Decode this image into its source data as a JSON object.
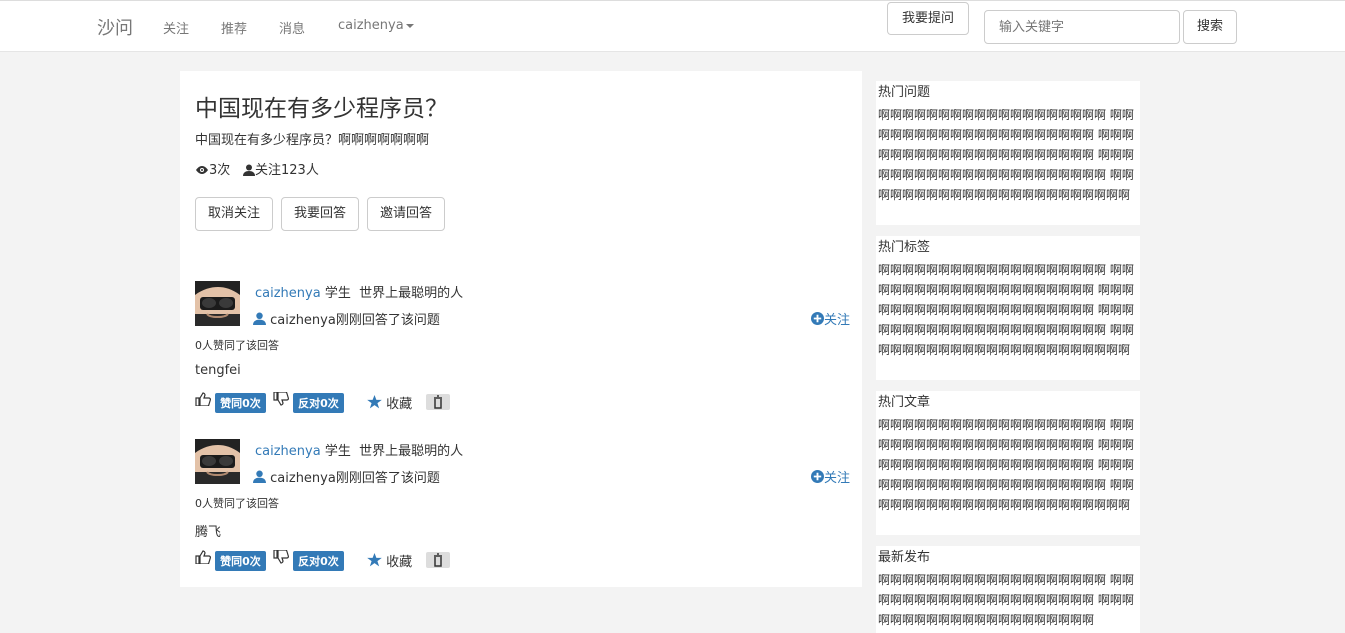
{
  "nav": {
    "brand": "沙问",
    "items": [
      "关注",
      "推荐",
      "消息"
    ],
    "user": "caizhenya",
    "ask_button": "我要提问",
    "search_placeholder": "输入关键字",
    "search_button": "搜索"
  },
  "question": {
    "title": "中国现在有多少程序员？",
    "description": "中国现在有多少程序员？啊啊啊啊啊啊啊",
    "views": "3次",
    "followers": "关注123人",
    "buttons": [
      "取消关注",
      "我要回答",
      "邀请回答"
    ]
  },
  "answers": [
    {
      "username": "caizhenya",
      "role": "学生",
      "bio": "世界上最聪明的人",
      "action": "caizhenya刚刚回答了该问题",
      "follow": "关注",
      "agree_text": "0人赞同了该回答",
      "content": "tengfei",
      "agree_label": "赞同0次",
      "oppose_label": "反对0次",
      "favorite": "收藏"
    },
    {
      "username": "caizhenya",
      "role": "学生",
      "bio": "世界上最聪明的人",
      "action": "caizhenya刚刚回答了该问题",
      "follow": "关注",
      "agree_text": "0人赞同了该回答",
      "content": "腾飞",
      "agree_label": "赞同0次",
      "oppose_label": "反对0次",
      "favorite": "收藏"
    }
  ],
  "sidebar": [
    {
      "title": "热门问题",
      "body": "啊啊啊啊啊啊啊啊啊啊啊啊啊啊啊啊啊啊啊 啊啊啊啊啊啊啊啊啊啊啊啊啊啊啊啊啊啊啊啊 啊啊啊啊啊啊啊啊啊啊啊啊啊啊啊啊啊啊啊啊啊 啊啊啊啊啊啊啊啊啊啊啊啊啊啊啊啊啊啊啊啊啊啊 啊啊啊啊啊啊啊啊啊啊啊啊啊啊啊啊啊啊啊啊啊啊啊"
    },
    {
      "title": "热门标签",
      "body": "啊啊啊啊啊啊啊啊啊啊啊啊啊啊啊啊啊啊啊 啊啊啊啊啊啊啊啊啊啊啊啊啊啊啊啊啊啊啊啊 啊啊啊啊啊啊啊啊啊啊啊啊啊啊啊啊啊啊啊啊啊 啊啊啊啊啊啊啊啊啊啊啊啊啊啊啊啊啊啊啊啊啊啊 啊啊啊啊啊啊啊啊啊啊啊啊啊啊啊啊啊啊啊啊啊啊啊"
    },
    {
      "title": "热门文章",
      "body": "啊啊啊啊啊啊啊啊啊啊啊啊啊啊啊啊啊啊啊 啊啊啊啊啊啊啊啊啊啊啊啊啊啊啊啊啊啊啊啊 啊啊啊啊啊啊啊啊啊啊啊啊啊啊啊啊啊啊啊啊啊 啊啊啊啊啊啊啊啊啊啊啊啊啊啊啊啊啊啊啊啊啊啊 啊啊啊啊啊啊啊啊啊啊啊啊啊啊啊啊啊啊啊啊啊啊啊"
    },
    {
      "title": "最新发布",
      "body": "啊啊啊啊啊啊啊啊啊啊啊啊啊啊啊啊啊啊啊 啊啊啊啊啊啊啊啊啊啊啊啊啊啊啊啊啊啊啊啊 啊啊啊啊啊啊啊啊啊啊啊啊啊啊啊啊啊啊啊啊啊"
    }
  ]
}
